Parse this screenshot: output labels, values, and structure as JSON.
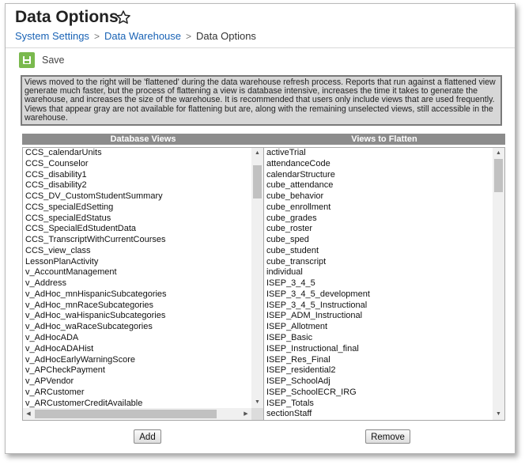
{
  "page": {
    "title": "Data Options",
    "star_icon": "star-outline-icon"
  },
  "breadcrumb": {
    "items": [
      "System Settings",
      "Data Warehouse"
    ],
    "current": "Data Options",
    "separator": ">"
  },
  "toolbar": {
    "save_label": "Save",
    "save_icon": "floppy-disk-icon",
    "save_color": "#7ab94e"
  },
  "note": {
    "text": "Views moved to the right will be 'flattened' during the data warehouse refresh process. Reports that run against a flattened view generate much faster, but the process of flattening a view is database intensive, increases the time it takes to generate the warehouse, and increases the size of the warehouse. It is recommended that users only include views that are used frequently. Views that appear gray are not available for flattening but are, along with the remaining unselected views, still accessible in the warehouse."
  },
  "database_views": {
    "header": "Database Views",
    "scroll_fraction": 0.03,
    "items": [
      "CCS_calendarUnits",
      "CCS_Counselor",
      "CCS_disability1",
      "CCS_disability2",
      "CCS_DV_CustomStudentSummary",
      "CCS_specialEdSetting",
      "CCS_specialEdStatus",
      "CCS_SpecialEdStudentData",
      "CCS_TranscriptWithCurrentCourses",
      "CCS_view_class",
      "LessonPlanActivity",
      "v_AccountManagement",
      "v_Address",
      "v_AdHoc_mnHispanicSubcategories",
      "v_AdHoc_mnRaceSubcategories",
      "v_AdHoc_waHispanicSubcategories",
      "v_AdHoc_waRaceSubcategories",
      "v_AdHocADA",
      "v_AdHocADAHist",
      "v_AdHocEarlyWarningScore",
      "v_APCheckPayment",
      "v_APVendor",
      "v_ARCustomer",
      "v_ARCustomerCreditAvailable"
    ],
    "add_label": "Add"
  },
  "views_to_flatten": {
    "header": "Views to Flatten",
    "scroll_fraction": 0.0,
    "items": [
      "activeTrial",
      "attendanceCode",
      "calendarStructure",
      "cube_attendance",
      "cube_behavior",
      "cube_enrollment",
      "cube_grades",
      "cube_roster",
      "cube_sped",
      "cube_student",
      "cube_transcript",
      "individual",
      "ISEP_3_4_5",
      "ISEP_3_4_5_development",
      "ISEP_3_4_5_Instructional",
      "ISEP_ADM_Instructional",
      "ISEP_Allotment",
      "ISEP_Basic",
      "ISEP_Instructional_final",
      "ISEP_Res_Final",
      "ISEP_residential2",
      "ISEP_SchoolAdj",
      "ISEP_SchoolECR_IRG",
      "ISEP_Totals",
      "sectionStaff"
    ],
    "remove_label": "Remove"
  }
}
